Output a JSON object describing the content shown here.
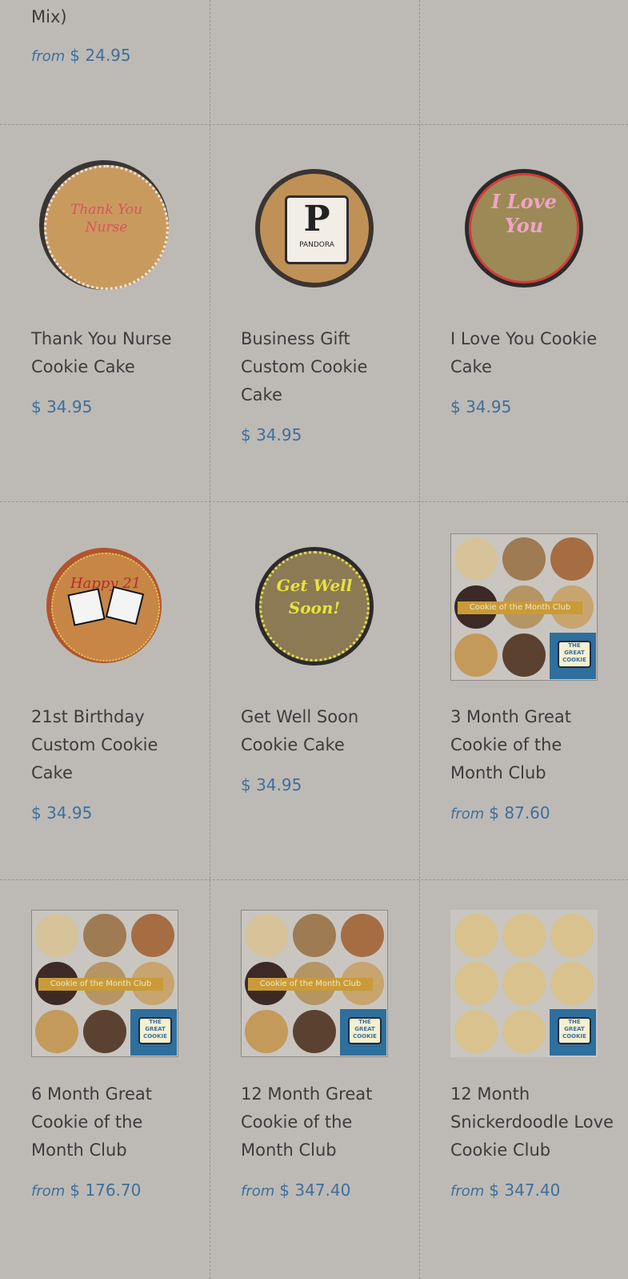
{
  "products": [
    {
      "name": "Mix)",
      "from": "from",
      "price": "$ 24.95"
    },
    {
      "name": "Thank You Nurse Cookie Cake",
      "from": "",
      "price": "$ 34.95",
      "image_text": "Thank You Nurse"
    },
    {
      "name": "Business Gift Custom Cookie Cake",
      "from": "",
      "price": "$ 34.95",
      "image_text": "P",
      "image_subtext": "PANDORA"
    },
    {
      "name": "I Love You Cookie Cake",
      "from": "",
      "price": "$ 34.95",
      "image_text": "I Love You"
    },
    {
      "name": "21st Birthday Custom Cookie Cake",
      "from": "",
      "price": "$ 34.95",
      "image_text": "Happy 21"
    },
    {
      "name": "Get Well Soon Cookie Cake",
      "from": "",
      "price": "$ 34.95",
      "image_text": "Get Well Soon!"
    },
    {
      "name": "3 Month Great Cookie of the Month Club",
      "from": "from",
      "price": "$ 87.60",
      "banner": "Cookie of the Month Club",
      "logo": "THE GREAT COOKIE"
    },
    {
      "name": "6 Month Great Cookie of the Month Club",
      "from": "from",
      "price": "$ 176.70",
      "banner": "Cookie of the Month Club",
      "logo": "THE GREAT COOKIE"
    },
    {
      "name": "12 Month Great Cookie of the Month Club",
      "from": "from",
      "price": "$ 347.40",
      "banner": "Cookie of the Month Club",
      "logo": "THE GREAT COOKIE"
    },
    {
      "name": "12 Month Snickerdoodle Love Cookie Club",
      "from": "from",
      "price": "$ 347.40",
      "logo": "THE GREAT COOKIE"
    }
  ],
  "colors": {
    "background": "#bdbab6",
    "price": "#3e6f9b",
    "text": "#3c3c3c"
  }
}
